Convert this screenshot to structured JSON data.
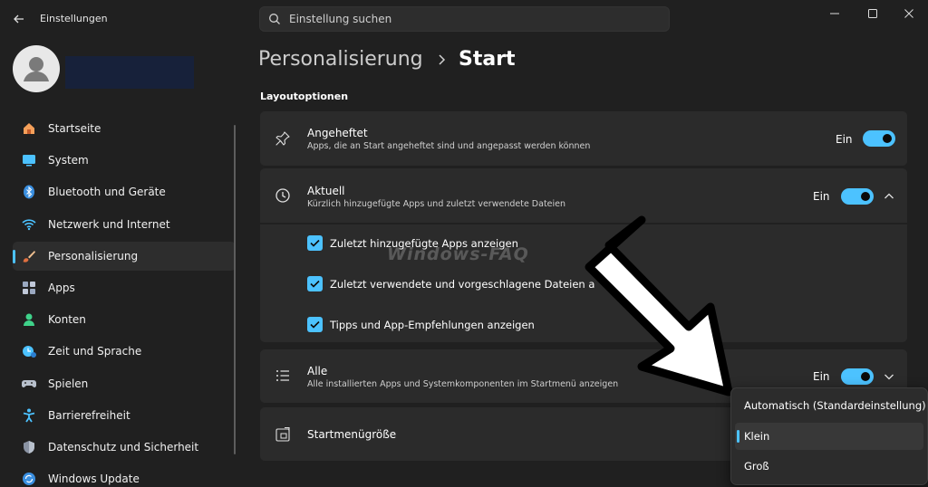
{
  "window": {
    "app_title": "Einstellungen",
    "search_placeholder": "Einstellung suchen"
  },
  "sidebar": {
    "items": [
      {
        "label": "Startseite",
        "icon": "home-icon",
        "active": false
      },
      {
        "label": "System",
        "icon": "monitor-icon",
        "active": false
      },
      {
        "label": "Bluetooth und Geräte",
        "icon": "bluetooth-icon",
        "active": false
      },
      {
        "label": "Netzwerk und Internet",
        "icon": "wifi-icon",
        "active": false
      },
      {
        "label": "Personalisierung",
        "icon": "brush-icon",
        "active": true
      },
      {
        "label": "Apps",
        "icon": "apps-icon",
        "active": false
      },
      {
        "label": "Konten",
        "icon": "person-icon",
        "active": false
      },
      {
        "label": "Zeit und Sprache",
        "icon": "clock-globe-icon",
        "active": false
      },
      {
        "label": "Spielen",
        "icon": "gamepad-icon",
        "active": false
      },
      {
        "label": "Barrierefreiheit",
        "icon": "accessibility-icon",
        "active": false
      },
      {
        "label": "Datenschutz und Sicherheit",
        "icon": "shield-icon",
        "active": false
      },
      {
        "label": "Windows Update",
        "icon": "update-icon",
        "active": false
      }
    ]
  },
  "breadcrumb": {
    "parent": "Personalisierung",
    "current": "Start"
  },
  "section": {
    "title": "Layoutoptionen"
  },
  "cards": {
    "pinned": {
      "title": "Angeheftet",
      "subtitle": "Apps, die an Start angeheftet sind und angepasst werden können",
      "state": "Ein"
    },
    "recent": {
      "title": "Aktuell",
      "subtitle": "Kürzlich hinzugefügte Apps und zuletzt verwendete Dateien",
      "state": "Ein",
      "options": [
        "Zuletzt hinzugefügte Apps anzeigen",
        "Zuletzt verwendete und vorgeschlagene Dateien a",
        "Tipps und App-Empfehlungen anzeigen"
      ]
    },
    "all": {
      "title": "Alle",
      "subtitle": "Alle installierten Apps und Systemkomponenten im Startmenü anzeigen",
      "state": "Ein"
    },
    "size": {
      "title": "Startmenügröße"
    }
  },
  "dropdown": {
    "options": [
      "Automatisch (Standardeinstellung)",
      "Klein",
      "Groß"
    ],
    "selected_index": 1
  },
  "watermark": "Windows-FAQ",
  "colors": {
    "accent": "#4cc2ff",
    "background": "#202020",
    "card": "#2b2b2b"
  }
}
